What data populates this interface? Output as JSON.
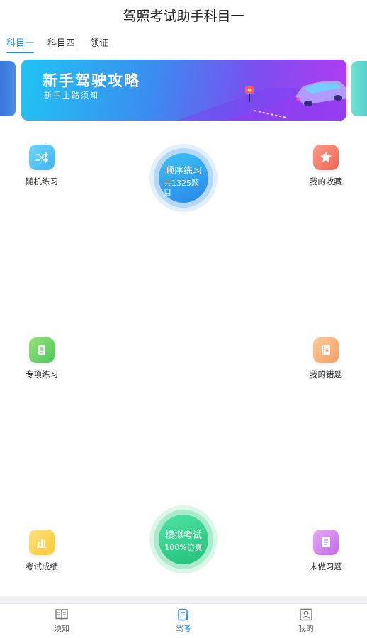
{
  "header": {
    "title": "驾照考试助手科目一"
  },
  "tabs": [
    {
      "label": "科目一",
      "active": true
    },
    {
      "label": "科目四",
      "active": false
    },
    {
      "label": "领证",
      "active": false
    }
  ],
  "banner": {
    "title": "新手驾驶攻略",
    "subtitle": "新手上路须知"
  },
  "grid": {
    "random_practice": {
      "label": "随机练习",
      "icon": "shuffle-icon",
      "color": "#5cc7f5"
    },
    "favorites": {
      "label": "我的收藏",
      "icon": "star-icon",
      "color": "#f47a6a"
    },
    "special_practice": {
      "label": "专项练习",
      "icon": "document-icon",
      "color": "#72d86a"
    },
    "wrong_questions": {
      "label": "我的错题",
      "icon": "error-book-icon",
      "color": "#f8b37a"
    },
    "exam_results": {
      "label": "考试成绩",
      "icon": "bar-chart-icon",
      "color": "#fbd64a"
    },
    "undone_questions": {
      "label": "未做习题",
      "icon": "notes-icon",
      "color": "#d68cf0"
    }
  },
  "sequential": {
    "title": "顺序练习",
    "subtitle": "共1325题目",
    "color": "#3ca2ef"
  },
  "mock_exam": {
    "title": "模拟考试",
    "subtitle": "100%仿真",
    "color": "#2fd38c"
  },
  "tabbar": [
    {
      "label": "须知",
      "icon": "book-icon",
      "active": false
    },
    {
      "label": "驾考",
      "icon": "exam-icon",
      "active": true
    },
    {
      "label": "我的",
      "icon": "profile-icon",
      "active": false
    }
  ]
}
